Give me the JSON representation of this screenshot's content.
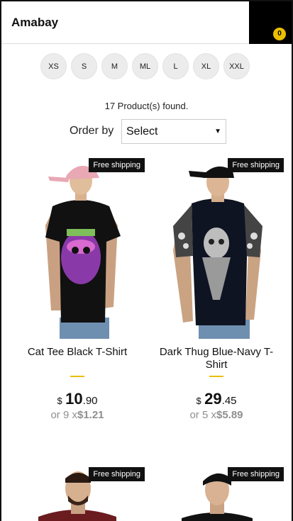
{
  "brand": "Amabay",
  "cart": {
    "count": "0"
  },
  "sizes": [
    "XS",
    "S",
    "M",
    "ML",
    "L",
    "XL",
    "XXL"
  ],
  "products_found": "17 Product(s) found.",
  "order_by": {
    "label": "Order by",
    "selected": "Select"
  },
  "products": [
    {
      "title": "Cat Tee Black T-Shirt",
      "tag": "Free shipping",
      "currency": "$",
      "price_int": "10",
      "price_dec": ".90",
      "installments_prefix": "or 9 x",
      "installment_value": "$1.21"
    },
    {
      "title": "Dark Thug Blue-Navy T-Shirt",
      "tag": "Free shipping",
      "currency": "$",
      "price_int": "29",
      "price_dec": ".45",
      "installments_prefix": "or 5 x",
      "installment_value": "$5.89"
    },
    {
      "tag": "Free shipping"
    },
    {
      "tag": "Free shipping"
    }
  ],
  "colors": {
    "accent": "#eabf00",
    "dark": "#111111"
  }
}
